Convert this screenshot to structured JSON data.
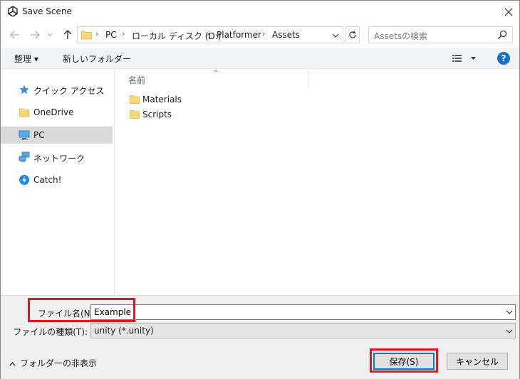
{
  "window": {
    "title": "Save Scene",
    "icons": {
      "app": "unity-logo-icon",
      "close": "close-icon"
    }
  },
  "nav": {
    "back_icon": "arrow-left-icon",
    "forward_icon": "arrow-right-icon",
    "recent_icon": "chevron-down-icon",
    "up_icon": "arrow-up-icon",
    "breadcrumb": [
      "PC",
      "ローカル ディスク (D:)",
      "Platformer",
      "Assets"
    ],
    "refresh_icon": "refresh-icon",
    "search_placeholder": "Assetsの検索",
    "search_icon": "search-icon"
  },
  "toolbar": {
    "organize_label": "整理 ▾",
    "new_folder_label": "新しいフォルダー",
    "view_icon": "view-options-icon",
    "help_icon": "help-icon",
    "help_label": "?"
  },
  "sidebar": {
    "items": [
      {
        "label": "クイック アクセス",
        "icon": "star-icon"
      },
      {
        "label": "OneDrive",
        "icon": "folder-icon"
      },
      {
        "label": "PC",
        "icon": "computer-icon",
        "selected": true
      },
      {
        "label": "ネットワーク",
        "icon": "network-icon"
      },
      {
        "label": "Catch!",
        "icon": "catch-app-icon"
      }
    ]
  },
  "filelist": {
    "column_name": "名前",
    "sort_indicator": "^",
    "items": [
      {
        "name": "Materials",
        "icon": "folder-icon"
      },
      {
        "name": "Scripts",
        "icon": "folder-icon"
      }
    ]
  },
  "form": {
    "filename_label": "ファイル名(N):",
    "filename_value": "Example",
    "filetype_label": "ファイルの種類(T):",
    "filetype_value": "unity (*.unity)",
    "hide_folders_label": "フォルダーの非表示",
    "save_label": "保存(S)",
    "cancel_label": "キャンセル"
  },
  "colors": {
    "highlight": "#e3141c",
    "accent": "#0078d7",
    "toolbar_bg": "#f0f4f9",
    "selected_bg": "#d9d9d9",
    "folder_yellow": "#f8d775"
  }
}
